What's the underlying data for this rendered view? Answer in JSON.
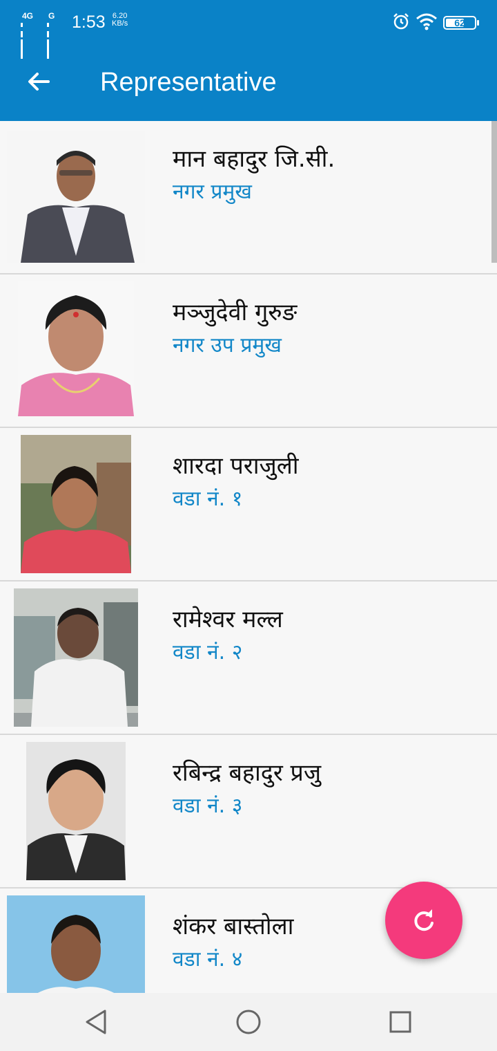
{
  "status_bar": {
    "network_1": "4G",
    "network_2": "G",
    "time": "1:53",
    "speed_value": "6.20",
    "speed_unit": "KB/s",
    "battery": "62",
    "icons": [
      "alarm-icon",
      "wifi-icon",
      "battery-icon"
    ]
  },
  "app_bar": {
    "title": "Representative",
    "back_icon": "arrow-back-icon",
    "color": "#0a82c7"
  },
  "representatives": [
    {
      "name": "मान बहादुर जि.सी.",
      "role": "नगर प्रमुख"
    },
    {
      "name": "मञ्जुदेवी गुरुङ",
      "role": "नगर उप प्रमुख"
    },
    {
      "name": "शारदा पराजुली",
      "role": "वडा नं. १"
    },
    {
      "name": "रामेश्वर मल्ल",
      "role": "वडा नं. २"
    },
    {
      "name": "रबिन्द्र बहादुर प्रजु",
      "role": "वडा नं. ३"
    },
    {
      "name": "शंकर बास्तोला",
      "role": "वडा नं. ४"
    }
  ],
  "fab": {
    "icon": "refresh-icon",
    "color": "#f43a7c"
  },
  "nav_bar": {
    "icons": [
      "back-triangle-icon",
      "home-circle-icon",
      "recents-square-icon"
    ]
  },
  "colors": {
    "accent_text": "#1287c8",
    "name_text": "#111111"
  }
}
